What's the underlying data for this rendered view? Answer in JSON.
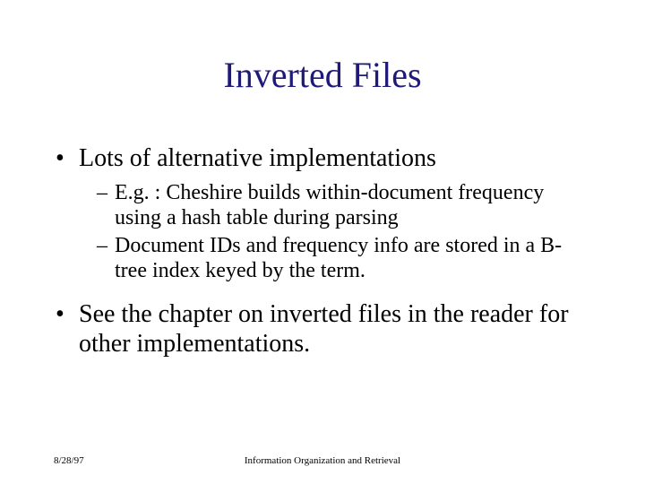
{
  "title": "Inverted Files",
  "bullets": [
    {
      "text": "Lots of alternative implementations",
      "sub": [
        "E.g. : Cheshire builds within-document frequency using a hash table during parsing",
        "Document IDs and frequency info are stored in a B-tree index keyed by the term."
      ]
    },
    {
      "text": "See the chapter on inverted files in the reader for other implementations.",
      "sub": []
    }
  ],
  "footer": {
    "date": "8/28/97",
    "center": "Information Organization and Retrieval"
  }
}
